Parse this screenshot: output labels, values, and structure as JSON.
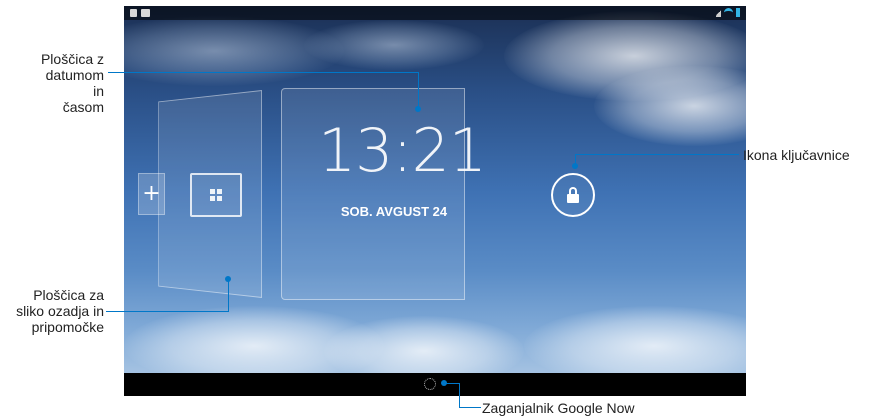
{
  "screen": {
    "clock": {
      "time": "13:21",
      "date": "SOB. AVGUST 24"
    },
    "add_widget_symbol": "+",
    "icons": {
      "lock": "lock-icon",
      "widgets": "widgets-icon",
      "google_now": "google-now-icon",
      "wifi": "wifi-icon",
      "battery": "battery-icon"
    }
  },
  "callouts": {
    "clock_tile_line1": "Ploščica z",
    "clock_tile_line2": "datumom in",
    "clock_tile_line3": "časom",
    "widget_tile_line1": "Ploščica za",
    "widget_tile_line2": "sliko ozadja in",
    "widget_tile_line3": "pripomočke",
    "lock_icon": "Ikona ključavnice",
    "google_now": "Zaganjalnik Google Now"
  },
  "colors": {
    "callout_line": "#0077c8",
    "status_icon_accent": "#33b5e5"
  }
}
